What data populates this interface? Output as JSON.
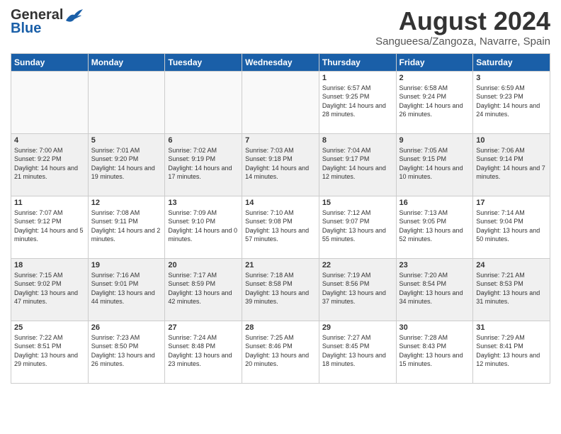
{
  "header": {
    "logo_general": "General",
    "logo_blue": "Blue",
    "month_year": "August 2024",
    "location": "Sangueesa/Zangoza, Navarre, Spain"
  },
  "days_of_week": [
    "Sunday",
    "Monday",
    "Tuesday",
    "Wednesday",
    "Thursday",
    "Friday",
    "Saturday"
  ],
  "weeks": [
    [
      {
        "day": "",
        "sunrise": "",
        "sunset": "",
        "daylight": ""
      },
      {
        "day": "",
        "sunrise": "",
        "sunset": "",
        "daylight": ""
      },
      {
        "day": "",
        "sunrise": "",
        "sunset": "",
        "daylight": ""
      },
      {
        "day": "",
        "sunrise": "",
        "sunset": "",
        "daylight": ""
      },
      {
        "day": "1",
        "sunrise": "6:57 AM",
        "sunset": "9:25 PM",
        "daylight": "14 hours and 28 minutes."
      },
      {
        "day": "2",
        "sunrise": "6:58 AM",
        "sunset": "9:24 PM",
        "daylight": "14 hours and 26 minutes."
      },
      {
        "day": "3",
        "sunrise": "6:59 AM",
        "sunset": "9:23 PM",
        "daylight": "14 hours and 24 minutes."
      }
    ],
    [
      {
        "day": "4",
        "sunrise": "7:00 AM",
        "sunset": "9:22 PM",
        "daylight": "14 hours and 21 minutes."
      },
      {
        "day": "5",
        "sunrise": "7:01 AM",
        "sunset": "9:20 PM",
        "daylight": "14 hours and 19 minutes."
      },
      {
        "day": "6",
        "sunrise": "7:02 AM",
        "sunset": "9:19 PM",
        "daylight": "14 hours and 17 minutes."
      },
      {
        "day": "7",
        "sunrise": "7:03 AM",
        "sunset": "9:18 PM",
        "daylight": "14 hours and 14 minutes."
      },
      {
        "day": "8",
        "sunrise": "7:04 AM",
        "sunset": "9:17 PM",
        "daylight": "14 hours and 12 minutes."
      },
      {
        "day": "9",
        "sunrise": "7:05 AM",
        "sunset": "9:15 PM",
        "daylight": "14 hours and 10 minutes."
      },
      {
        "day": "10",
        "sunrise": "7:06 AM",
        "sunset": "9:14 PM",
        "daylight": "14 hours and 7 minutes."
      }
    ],
    [
      {
        "day": "11",
        "sunrise": "7:07 AM",
        "sunset": "9:12 PM",
        "daylight": "14 hours and 5 minutes."
      },
      {
        "day": "12",
        "sunrise": "7:08 AM",
        "sunset": "9:11 PM",
        "daylight": "14 hours and 2 minutes."
      },
      {
        "day": "13",
        "sunrise": "7:09 AM",
        "sunset": "9:10 PM",
        "daylight": "14 hours and 0 minutes."
      },
      {
        "day": "14",
        "sunrise": "7:10 AM",
        "sunset": "9:08 PM",
        "daylight": "13 hours and 57 minutes."
      },
      {
        "day": "15",
        "sunrise": "7:12 AM",
        "sunset": "9:07 PM",
        "daylight": "13 hours and 55 minutes."
      },
      {
        "day": "16",
        "sunrise": "7:13 AM",
        "sunset": "9:05 PM",
        "daylight": "13 hours and 52 minutes."
      },
      {
        "day": "17",
        "sunrise": "7:14 AM",
        "sunset": "9:04 PM",
        "daylight": "13 hours and 50 minutes."
      }
    ],
    [
      {
        "day": "18",
        "sunrise": "7:15 AM",
        "sunset": "9:02 PM",
        "daylight": "13 hours and 47 minutes."
      },
      {
        "day": "19",
        "sunrise": "7:16 AM",
        "sunset": "9:01 PM",
        "daylight": "13 hours and 44 minutes."
      },
      {
        "day": "20",
        "sunrise": "7:17 AM",
        "sunset": "8:59 PM",
        "daylight": "13 hours and 42 minutes."
      },
      {
        "day": "21",
        "sunrise": "7:18 AM",
        "sunset": "8:58 PM",
        "daylight": "13 hours and 39 minutes."
      },
      {
        "day": "22",
        "sunrise": "7:19 AM",
        "sunset": "8:56 PM",
        "daylight": "13 hours and 37 minutes."
      },
      {
        "day": "23",
        "sunrise": "7:20 AM",
        "sunset": "8:54 PM",
        "daylight": "13 hours and 34 minutes."
      },
      {
        "day": "24",
        "sunrise": "7:21 AM",
        "sunset": "8:53 PM",
        "daylight": "13 hours and 31 minutes."
      }
    ],
    [
      {
        "day": "25",
        "sunrise": "7:22 AM",
        "sunset": "8:51 PM",
        "daylight": "13 hours and 29 minutes."
      },
      {
        "day": "26",
        "sunrise": "7:23 AM",
        "sunset": "8:50 PM",
        "daylight": "13 hours and 26 minutes."
      },
      {
        "day": "27",
        "sunrise": "7:24 AM",
        "sunset": "8:48 PM",
        "daylight": "13 hours and 23 minutes."
      },
      {
        "day": "28",
        "sunrise": "7:25 AM",
        "sunset": "8:46 PM",
        "daylight": "13 hours and 20 minutes."
      },
      {
        "day": "29",
        "sunrise": "7:27 AM",
        "sunset": "8:45 PM",
        "daylight": "13 hours and 18 minutes."
      },
      {
        "day": "30",
        "sunrise": "7:28 AM",
        "sunset": "8:43 PM",
        "daylight": "13 hours and 15 minutes."
      },
      {
        "day": "31",
        "sunrise": "7:29 AM",
        "sunset": "8:41 PM",
        "daylight": "13 hours and 12 minutes."
      }
    ]
  ]
}
